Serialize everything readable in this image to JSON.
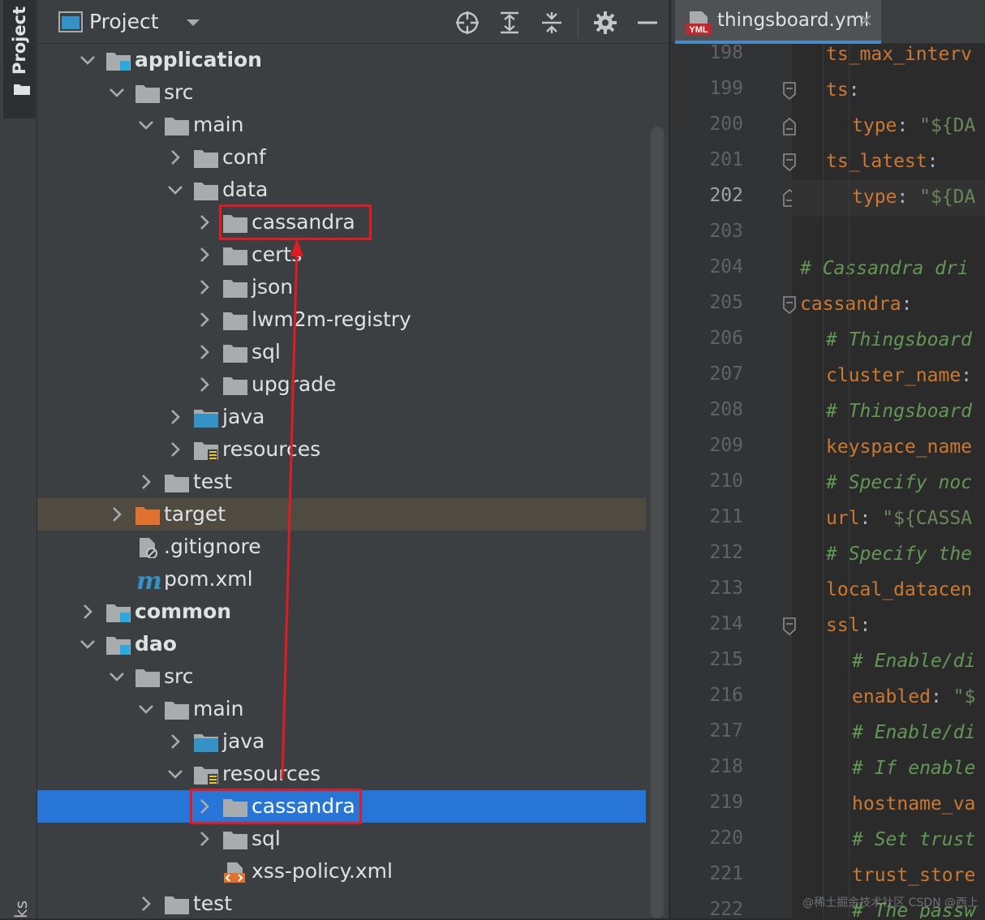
{
  "side_strip": {
    "project_tab": "Project",
    "bottom_tab": "ks"
  },
  "project_panel": {
    "title": "Project",
    "toolbar": [
      "locate-icon",
      "expand-all-icon",
      "collapse-all-icon",
      "gear-icon",
      "minimize-icon"
    ]
  },
  "tree": [
    {
      "label": "application",
      "depth": 2,
      "chev": "down",
      "icon": "module",
      "bold": true
    },
    {
      "label": "src",
      "depth": 3,
      "chev": "down",
      "icon": "folder"
    },
    {
      "label": "main",
      "depth": 4,
      "chev": "down",
      "icon": "folder"
    },
    {
      "label": "conf",
      "depth": 5,
      "chev": "right",
      "icon": "folder"
    },
    {
      "label": "data",
      "depth": 5,
      "chev": "down",
      "icon": "folder"
    },
    {
      "label": "cassandra",
      "depth": 6,
      "chev": "right",
      "icon": "folder",
      "boxed": true
    },
    {
      "label": "certs",
      "depth": 6,
      "chev": "right",
      "icon": "folder"
    },
    {
      "label": "json",
      "depth": 6,
      "chev": "right",
      "icon": "folder"
    },
    {
      "label": "lwm2m-registry",
      "depth": 6,
      "chev": "right",
      "icon": "folder"
    },
    {
      "label": "sql",
      "depth": 6,
      "chev": "right",
      "icon": "folder"
    },
    {
      "label": "upgrade",
      "depth": 6,
      "chev": "right",
      "icon": "folder"
    },
    {
      "label": "java",
      "depth": 5,
      "chev": "right",
      "icon": "source"
    },
    {
      "label": "resources",
      "depth": 5,
      "chev": "right",
      "icon": "resources"
    },
    {
      "label": "test",
      "depth": 4,
      "chev": "right",
      "icon": "folder"
    },
    {
      "label": "target",
      "depth": 3,
      "chev": "right",
      "icon": "excluded",
      "highlight": true
    },
    {
      "label": ".gitignore",
      "depth": 3,
      "chev": "none",
      "icon": "gitignore"
    },
    {
      "label": "pom.xml",
      "depth": 3,
      "chev": "none",
      "icon": "maven"
    },
    {
      "label": "common",
      "depth": 2,
      "chev": "right",
      "icon": "module",
      "bold": true
    },
    {
      "label": "dao",
      "depth": 2,
      "chev": "down",
      "icon": "module",
      "bold": true
    },
    {
      "label": "src",
      "depth": 3,
      "chev": "down",
      "icon": "folder"
    },
    {
      "label": "main",
      "depth": 4,
      "chev": "down",
      "icon": "folder"
    },
    {
      "label": "java",
      "depth": 5,
      "chev": "right",
      "icon": "source"
    },
    {
      "label": "resources",
      "depth": 5,
      "chev": "down",
      "icon": "resources"
    },
    {
      "label": "cassandra",
      "depth": 6,
      "chev": "right",
      "icon": "folder",
      "selected": true,
      "boxed": true
    },
    {
      "label": "sql",
      "depth": 6,
      "chev": "right",
      "icon": "folder"
    },
    {
      "label": "xss-policy.xml",
      "depth": 6,
      "chev": "none",
      "icon": "xml"
    },
    {
      "label": "test",
      "depth": 4,
      "chev": "right",
      "icon": "folder"
    }
  ],
  "editor": {
    "tab": {
      "name": "thingsboard.yml",
      "icon": "yml-icon",
      "badge": "YML"
    },
    "current_line": "202",
    "lines": [
      {
        "n": "198",
        "fold": "none",
        "indent": 1,
        "parts": [
          {
            "t": "k",
            "v": "ts_max_interv"
          }
        ]
      },
      {
        "n": "199",
        "fold": "open",
        "indent": 1,
        "parts": [
          {
            "t": "k",
            "v": "ts"
          },
          {
            "t": "p",
            "v": ":"
          }
        ]
      },
      {
        "n": "200",
        "fold": "end",
        "indent": 2,
        "parts": [
          {
            "t": "k",
            "v": "type"
          },
          {
            "t": "p",
            "v": ": "
          },
          {
            "t": "s",
            "v": "\"${DA"
          }
        ]
      },
      {
        "n": "201",
        "fold": "open",
        "indent": 1,
        "parts": [
          {
            "t": "k",
            "v": "ts_latest"
          },
          {
            "t": "p",
            "v": ":"
          }
        ]
      },
      {
        "n": "202",
        "fold": "end",
        "indent": 2,
        "parts": [
          {
            "t": "k",
            "v": "type"
          },
          {
            "t": "p",
            "v": ": "
          },
          {
            "t": "s",
            "v": "\"${DA"
          }
        ]
      },
      {
        "n": "203",
        "fold": "none",
        "indent": 0,
        "parts": []
      },
      {
        "n": "204",
        "fold": "none",
        "indent": 0,
        "parts": [
          {
            "t": "c",
            "v": "# Cassandra dri"
          }
        ]
      },
      {
        "n": "205",
        "fold": "open",
        "indent": 0,
        "parts": [
          {
            "t": "k",
            "v": "cassandra"
          },
          {
            "t": "p",
            "v": ":"
          }
        ]
      },
      {
        "n": "206",
        "fold": "none",
        "indent": 1,
        "parts": [
          {
            "t": "c",
            "v": "# Thingsboard"
          }
        ]
      },
      {
        "n": "207",
        "fold": "none",
        "indent": 1,
        "parts": [
          {
            "t": "k",
            "v": "cluster_name"
          },
          {
            "t": "p",
            "v": ":"
          }
        ]
      },
      {
        "n": "208",
        "fold": "none",
        "indent": 1,
        "parts": [
          {
            "t": "c",
            "v": "# Thingsboard"
          }
        ]
      },
      {
        "n": "209",
        "fold": "none",
        "indent": 1,
        "parts": [
          {
            "t": "k",
            "v": "keyspace_name"
          }
        ]
      },
      {
        "n": "210",
        "fold": "none",
        "indent": 1,
        "parts": [
          {
            "t": "c",
            "v": "# Specify noc"
          }
        ]
      },
      {
        "n": "211",
        "fold": "none",
        "indent": 1,
        "parts": [
          {
            "t": "k",
            "v": "url"
          },
          {
            "t": "p",
            "v": ": "
          },
          {
            "t": "s",
            "v": "\"${CASSA"
          }
        ]
      },
      {
        "n": "212",
        "fold": "none",
        "indent": 1,
        "parts": [
          {
            "t": "c",
            "v": "# Specify the"
          }
        ]
      },
      {
        "n": "213",
        "fold": "none",
        "indent": 1,
        "parts": [
          {
            "t": "k",
            "v": "local_datacen"
          }
        ]
      },
      {
        "n": "214",
        "fold": "open",
        "indent": 1,
        "parts": [
          {
            "t": "k",
            "v": "ssl"
          },
          {
            "t": "p",
            "v": ":"
          }
        ]
      },
      {
        "n": "215",
        "fold": "none",
        "indent": 2,
        "parts": [
          {
            "t": "c",
            "v": "# Enable/di"
          }
        ]
      },
      {
        "n": "216",
        "fold": "none",
        "indent": 2,
        "parts": [
          {
            "t": "k",
            "v": "enabled"
          },
          {
            "t": "p",
            "v": ": "
          },
          {
            "t": "s",
            "v": "\"$"
          }
        ]
      },
      {
        "n": "217",
        "fold": "none",
        "indent": 2,
        "parts": [
          {
            "t": "c",
            "v": "# Enable/di"
          }
        ]
      },
      {
        "n": "218",
        "fold": "none",
        "indent": 2,
        "parts": [
          {
            "t": "c",
            "v": "# If enable"
          }
        ]
      },
      {
        "n": "219",
        "fold": "none",
        "indent": 2,
        "parts": [
          {
            "t": "k",
            "v": "hostname_va"
          }
        ]
      },
      {
        "n": "220",
        "fold": "none",
        "indent": 2,
        "parts": [
          {
            "t": "c",
            "v": "# Set trust"
          }
        ]
      },
      {
        "n": "221",
        "fold": "none",
        "indent": 2,
        "parts": [
          {
            "t": "k",
            "v": "trust_store"
          }
        ]
      },
      {
        "n": "222",
        "fold": "none",
        "indent": 2,
        "parts": [
          {
            "t": "c",
            "v": "# The passw"
          }
        ]
      }
    ]
  },
  "watermark": "@稀土掘金技术社区 CSDN @西上",
  "colors": {
    "selection": "#2675d7",
    "redbox": "#e01b24",
    "keyword": "#cc7832",
    "string": "#6a8759",
    "comment": "#629755",
    "folder": "#a9acaf",
    "module_badge": "#29a9e0",
    "excluded_folder": "#e0712e"
  }
}
